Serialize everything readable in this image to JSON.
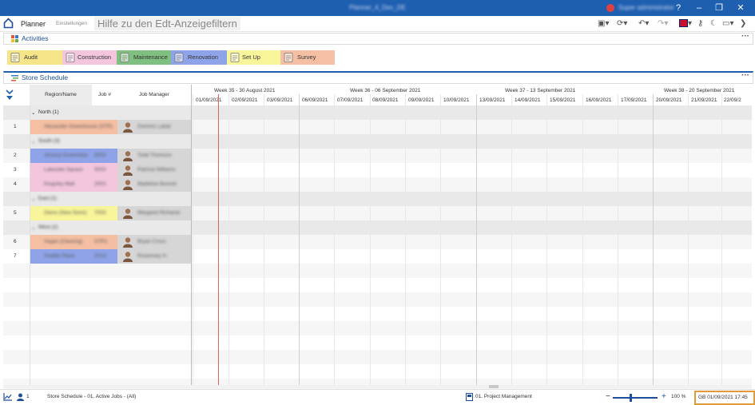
{
  "window": {
    "title": "Planner_4_Dev_DE",
    "user": "Super administrator"
  },
  "menu": {
    "planner": "Planner",
    "settings": "Einstellungen",
    "help": "Hilfe zu den Edt-Anzeigefiltern"
  },
  "activities": {
    "title": "Activities",
    "items": [
      {
        "label": "Audit",
        "color": "#f7e58a"
      },
      {
        "label": "Construction",
        "color": "#f3c6dd"
      },
      {
        "label": "Maintenance",
        "color": "#7fbf7f"
      },
      {
        "label": "Renovation",
        "color": "#8fa4e8"
      },
      {
        "label": "Set Up",
        "color": "#f8f59a"
      },
      {
        "label": "Survey",
        "color": "#f5bfa3"
      }
    ]
  },
  "schedule": {
    "title": "Store Schedule",
    "columns": [
      "Region/Name",
      "Job #",
      "Job Manager"
    ],
    "weeks": [
      "Week 35 - 30 August 2021",
      "Week 36 - 06 September 2021",
      "Week 37 - 13 September 2021",
      "Week 38 - 20 September 2021"
    ],
    "days": [
      "01/09/2021",
      "02/09/2021",
      "03/09/2021",
      "06/09/2021",
      "07/09/2021",
      "08/09/2021",
      "09/09/2021",
      "10/09/2021",
      "13/09/2021",
      "14/09/2021",
      "15/09/2021",
      "16/09/2021",
      "17/09/2021",
      "20/09/2021",
      "21/09/2021",
      "22/09/2"
    ],
    "groups": [
      {
        "label": "North (1)"
      },
      {
        "label": "South (3)"
      },
      {
        "label": "East (1)"
      },
      {
        "label": "West (2)"
      }
    ],
    "rows": [
      {
        "num": "1",
        "name": "Alexander Greenhouse (STR)",
        "job": "",
        "manager": "Dominic Labat",
        "color": "#f5bfa3"
      },
      {
        "num": "2",
        "name": "Jessica Greenview",
        "job": "8003",
        "manager": "Todd Thomson",
        "color": "#8fa4e8"
      },
      {
        "num": "3",
        "name": "Lakeside Square",
        "job": "5003",
        "manager": "Patricia Williams",
        "color": "#f3c6dd"
      },
      {
        "num": "4",
        "name": "Kingsley Mall",
        "job": "2003",
        "manager": "Madeline Bonnet",
        "color": "#f3c6dd"
      },
      {
        "num": "5",
        "name": "Glens (New Store)",
        "job": "7003",
        "manager": "Margaret Richards",
        "color": "#f8f59a"
      },
      {
        "num": "6",
        "name": "Vegas (Clearing)",
        "job": "STR1",
        "manager": "Bryan Cross",
        "color": "#f5bfa3"
      },
      {
        "num": "7",
        "name": "Seattle Plaza",
        "job": "2013",
        "manager": "Rosemary H.",
        "color": "#8fa4e8"
      }
    ]
  },
  "status": {
    "count": "1",
    "view": "Store Schedule - 01. Active Jobs - (All)",
    "project": "01. Project Management",
    "zoom_pct": "100 %",
    "datetime": "GB 01/09/2021 17:45",
    "zoom_value": 40
  }
}
